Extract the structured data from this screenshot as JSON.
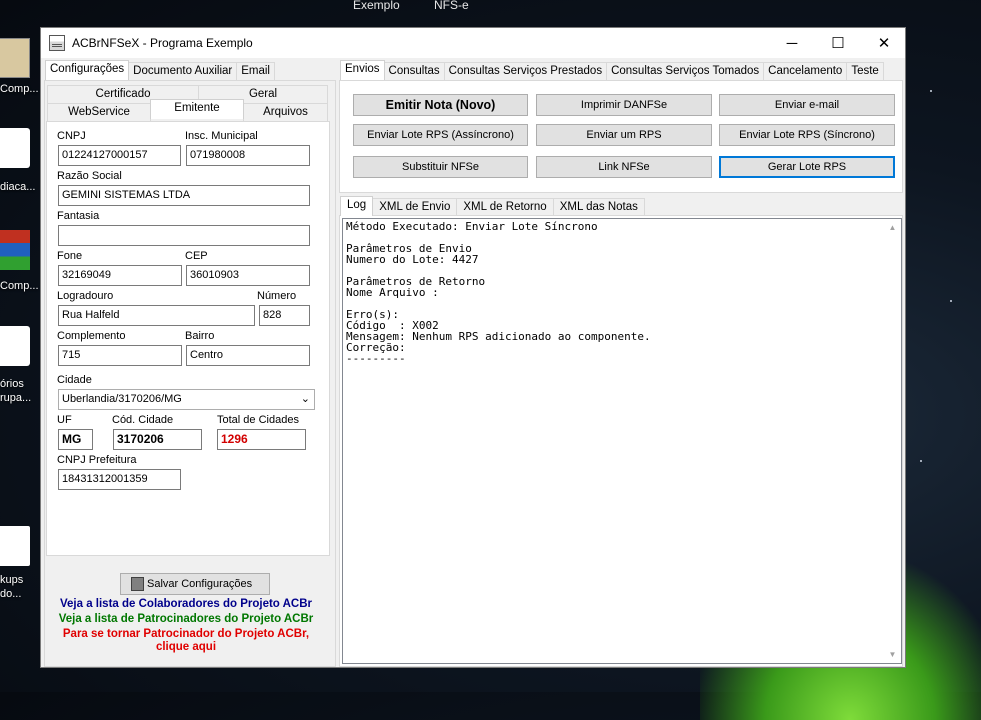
{
  "desktop": {
    "topbar": [
      "Exemplo",
      "NFS-e"
    ],
    "icon_labels": [
      "Comp...",
      "diaca...",
      "Comp...",
      "órios\nrupa...",
      "kups\ndo..."
    ]
  },
  "window": {
    "title": "ACBrNFSeX - Programa Exemplo",
    "controls": {
      "minimize": "─",
      "maximize": "☐",
      "close": "✕"
    }
  },
  "left": {
    "top_tabs": [
      "Configurações",
      "Documento Auxiliar",
      "Email"
    ],
    "sub_tabs_row1": [
      "Certificado",
      "Geral"
    ],
    "sub_tabs_row2": [
      "WebService",
      "Emitente",
      "Arquivos"
    ],
    "fields": {
      "cnpj_label": "CNPJ",
      "cnpj": "01224127000157",
      "im_label": "Insc. Municipal",
      "im": "071980008",
      "razao_label": "Razão Social",
      "razao": "GEMINI SISTEMAS LTDA",
      "fantasia_label": "Fantasia",
      "fantasia": "",
      "fone_label": "Fone",
      "fone": "32169049",
      "cep_label": "CEP",
      "cep": "36010903",
      "logradouro_label": "Logradouro",
      "logradouro": "Rua Halfeld",
      "numero_label": "Número",
      "numero": "828",
      "complemento_label": "Complemento",
      "complemento": "715",
      "bairro_label": "Bairro",
      "bairro": "Centro",
      "cidade_label": "Cidade",
      "cidade": "Uberlandia/3170206/MG",
      "uf_label": "UF",
      "uf": "MG",
      "cod_cidade_label": "Cód. Cidade",
      "cod_cidade": "3170206",
      "total_cidades_label": "Total de Cidades",
      "total_cidades": "1296",
      "cnpj_pref_label": "CNPJ Prefeitura",
      "cnpj_pref": "18431312001359"
    },
    "save_button": "Salvar Configurações",
    "links": {
      "colaboradores": "Veja a lista de Colaboradores do Projeto ACBr",
      "patrocinadores": "Veja a lista de Patrocinadores do Projeto ACBr",
      "patrocinador_line1": "Para se tornar Patrocinador do Projeto ACBr,",
      "patrocinador_line2": "clique aqui"
    },
    "colors": {
      "colaboradores": "#00008b",
      "patrocinadores": "#007700",
      "patrocinador": "#e00000"
    }
  },
  "right": {
    "top_tabs": [
      "Envios",
      "Consultas",
      "Consultas Serviços Prestados",
      "Consultas Serviços Tomados",
      "Cancelamento",
      "Teste"
    ],
    "buttons": {
      "emitir": "Emitir Nota (Novo)",
      "imprimir": "Imprimir DANFSe",
      "email": "Enviar e-mail",
      "lote_assinc": "Enviar Lote RPS (Assíncrono)",
      "um_rps": "Enviar um RPS",
      "lote_sinc": "Enviar Lote RPS (Síncrono)",
      "substituir": "Substituir NFSe",
      "link": "Link NFSe",
      "gerar_lote": "Gerar Lote RPS"
    },
    "log_tabs": [
      "Log",
      "XML de Envio",
      "XML de Retorno",
      "XML das Notas"
    ],
    "log_text": "Método Executado: Enviar Lote Síncrono\n\nParâmetros de Envio\nNumero do Lote: 4427\n\nParâmetros de Retorno\nNome Arquivo :\n\nErro(s):\nCódigo  : X002\nMensagem: Nenhum RPS adicionado ao componente.\nCorreção:\n---------"
  }
}
